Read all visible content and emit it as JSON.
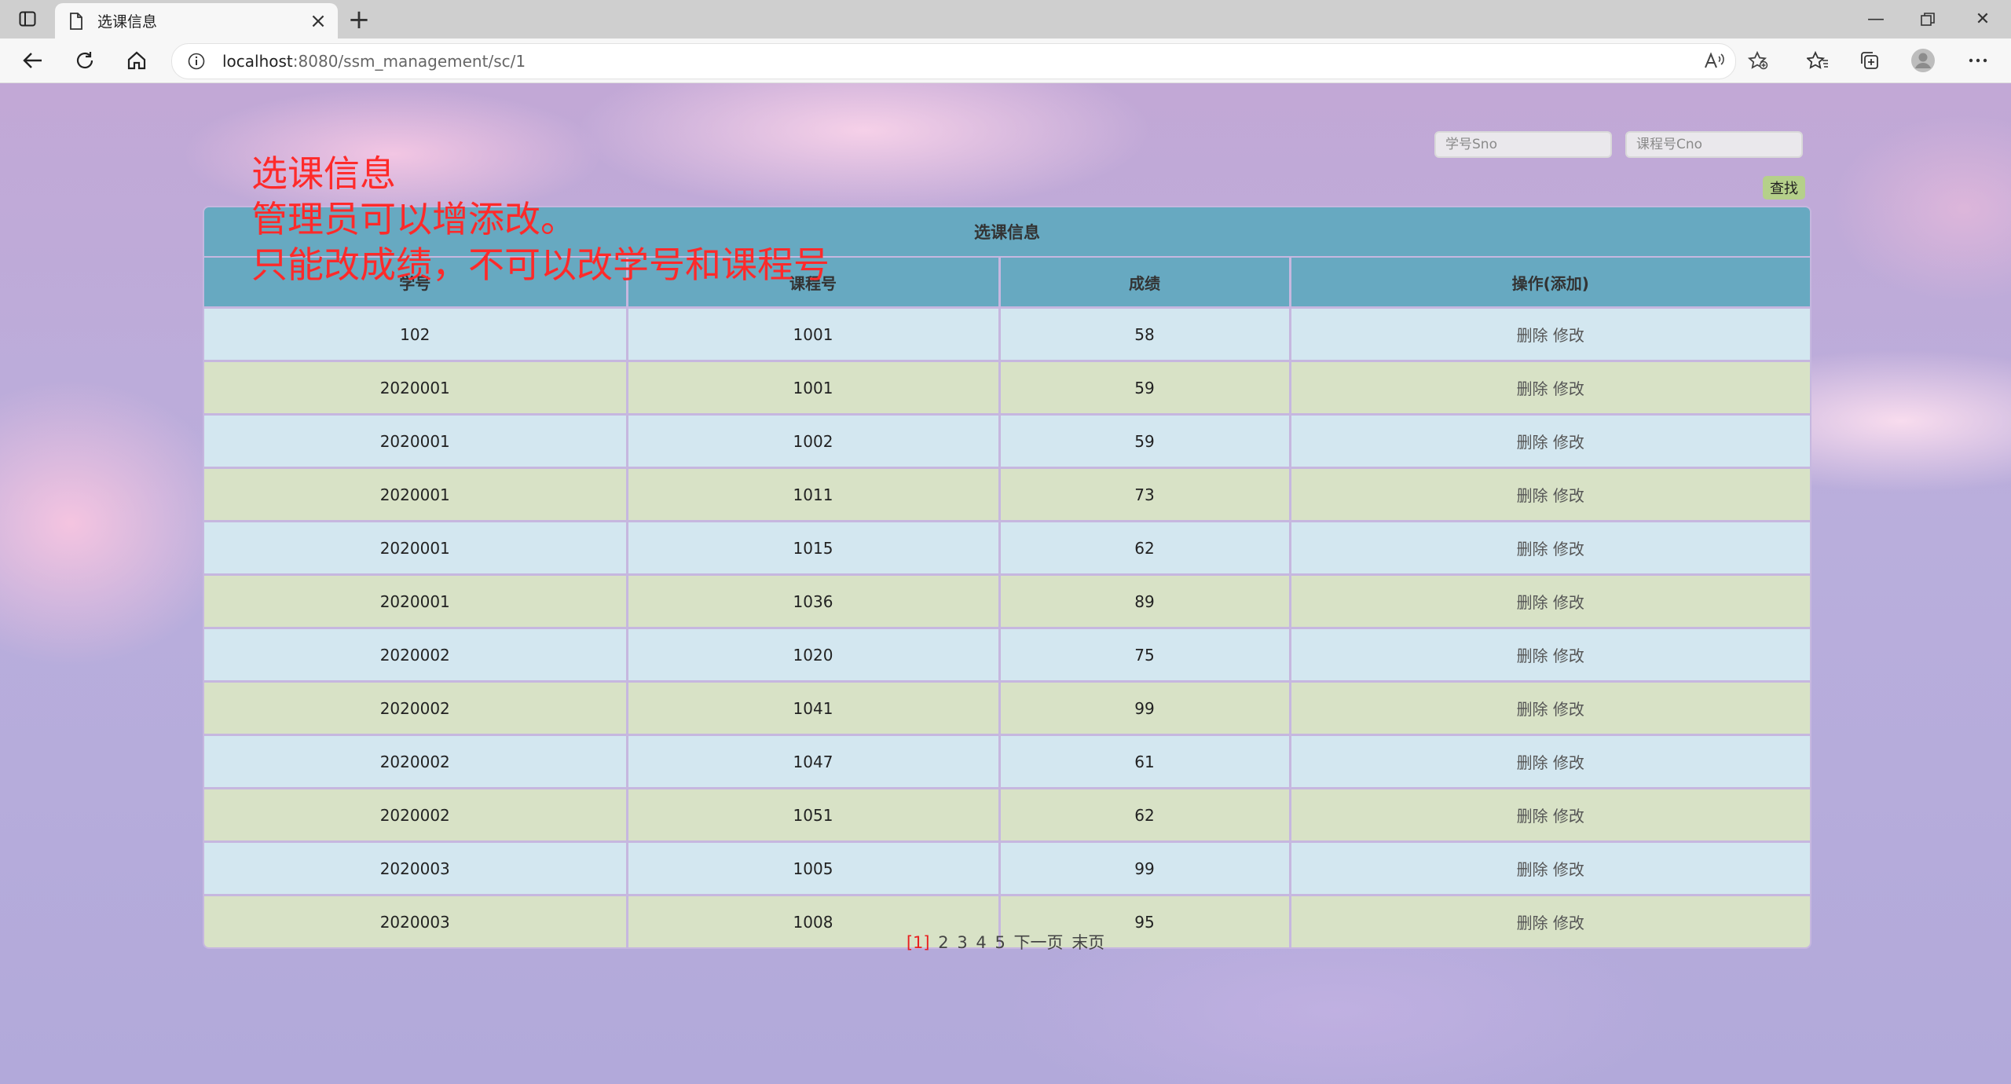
{
  "browser": {
    "tab_title": "选课信息",
    "url_host": "localhost",
    "url_rest": ":8080/ssm_management/sc/1"
  },
  "annotation": {
    "line1": "选课信息",
    "line2": "管理员可以增添改。",
    "line3": "只能改成绩，不可以改学号和课程号"
  },
  "search": {
    "sno_placeholder": "学号Sno",
    "cno_placeholder": "课程号Cno",
    "button_label": "查找"
  },
  "table": {
    "caption": "选课信息",
    "headers": [
      "学号",
      "课程号",
      "成绩",
      "操作(添加)"
    ],
    "delete_label": "删除",
    "edit_label": "修改",
    "rows": [
      {
        "sno": "102",
        "cno": "1001",
        "grade": "58"
      },
      {
        "sno": "2020001",
        "cno": "1001",
        "grade": "59"
      },
      {
        "sno": "2020001",
        "cno": "1002",
        "grade": "59"
      },
      {
        "sno": "2020001",
        "cno": "1011",
        "grade": "73"
      },
      {
        "sno": "2020001",
        "cno": "1015",
        "grade": "62"
      },
      {
        "sno": "2020001",
        "cno": "1036",
        "grade": "89"
      },
      {
        "sno": "2020002",
        "cno": "1020",
        "grade": "75"
      },
      {
        "sno": "2020002",
        "cno": "1041",
        "grade": "99"
      },
      {
        "sno": "2020002",
        "cno": "1047",
        "grade": "61"
      },
      {
        "sno": "2020002",
        "cno": "1051",
        "grade": "62"
      },
      {
        "sno": "2020003",
        "cno": "1005",
        "grade": "99"
      },
      {
        "sno": "2020003",
        "cno": "1008",
        "grade": "95"
      }
    ]
  },
  "pager": {
    "current": "[1]",
    "pages": [
      "2",
      "3",
      "4",
      "5"
    ],
    "next": "下一页",
    "last": "末页"
  },
  "colors": {
    "header_bg": "#67a9c1",
    "row_odd": "#d3e7f0",
    "row_even": "#d8e2c6",
    "annotation": "#ff2a2a",
    "search_button": "#b5d08a",
    "pager_current": "#e82020"
  }
}
